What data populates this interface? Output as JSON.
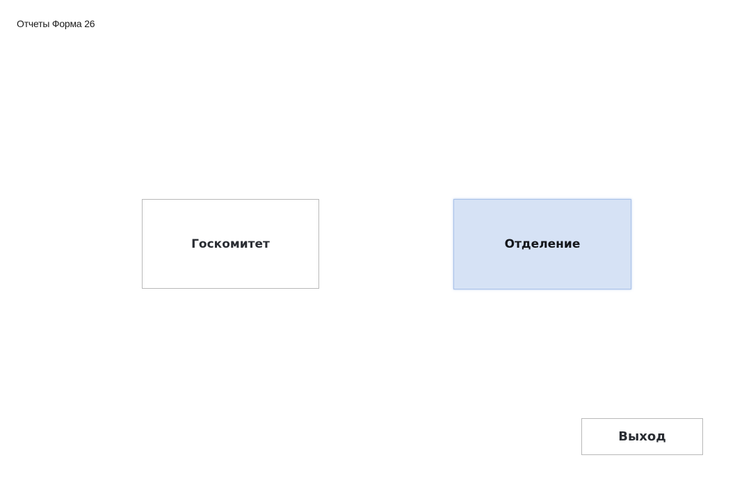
{
  "window": {
    "title": "Отчеты Форма 26"
  },
  "buttons": {
    "goskomitet": "Госкомитет",
    "otdelenie": "Отделение",
    "exit": "Выход"
  },
  "colors": {
    "background": "#ffffff",
    "focused_button_fill": "#d6e2f5",
    "focused_button_border": "#a9c1e8",
    "button_border": "#b8b8b8"
  },
  "state": {
    "focused_button": "otdelenie"
  }
}
